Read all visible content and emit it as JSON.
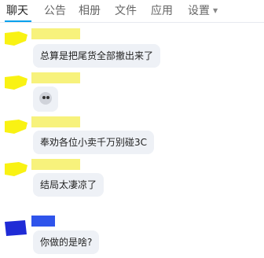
{
  "tabs": [
    {
      "label": "聊天",
      "active": true
    },
    {
      "label": "公告"
    },
    {
      "label": "相册"
    },
    {
      "label": "文件"
    },
    {
      "label": "应用"
    },
    {
      "label": "设置"
    }
  ],
  "colors": {
    "accent": "#0aa1ed",
    "bubble": "#eef1f6",
    "avatar_yellow": "#f9f213",
    "avatar_blue": "#1f2bd6"
  },
  "messages": [
    {
      "text": "总算是把尾货全部撤出来了"
    },
    {
      "icon": "skull-icon"
    },
    {
      "text": "奉劝各位小卖千万别碰3C"
    },
    {
      "text": "结局太凄凉了"
    },
    {
      "text": "你做的是啥?"
    }
  ]
}
